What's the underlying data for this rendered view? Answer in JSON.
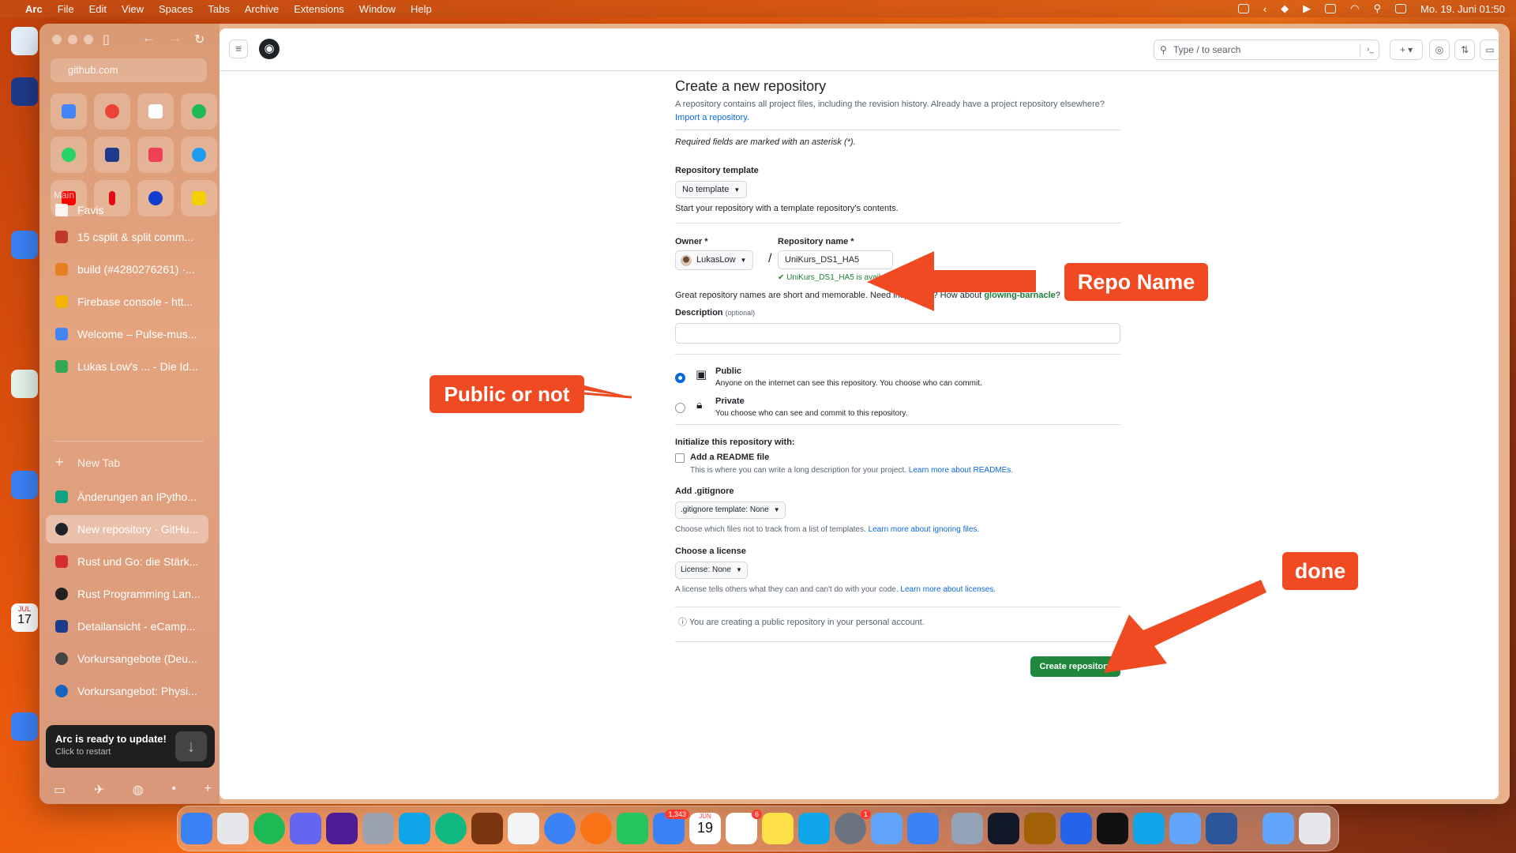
{
  "menubar": {
    "app": "Arc",
    "items": [
      "File",
      "Edit",
      "View",
      "Spaces",
      "Tabs",
      "Archive",
      "Extensions",
      "Window",
      "Help"
    ],
    "datetime": "Mo. 19. Juni 01:50"
  },
  "sidebar": {
    "url": "github.com",
    "sections": {
      "main": "Main",
      "favis": "Favis"
    },
    "pinned_tabs": [
      {
        "label": "15 csplit & split comm...",
        "color": "#c0392b"
      },
      {
        "label": "build (#4280276261) ·...",
        "color": "#e67e22"
      },
      {
        "label": "Firebase console - htt...",
        "color": "#f5b400"
      },
      {
        "label": "Welcome – Pulse-mus...",
        "color": "#4285f4"
      },
      {
        "label": "Lukas Low's ... - Die Id...",
        "color": "#34a853"
      }
    ],
    "new_tab": "New Tab",
    "tabs": [
      {
        "label": "Änderungen an IPytho...",
        "color": "#10a37f",
        "active": false
      },
      {
        "label": "New repository · GitHu...",
        "color": "#1f2328",
        "active": true
      },
      {
        "label": "Rust und Go: die Stärk...",
        "color": "#d32f2f",
        "active": false
      },
      {
        "label": "Rust Programming Lan...",
        "color": "#222222",
        "active": false
      },
      {
        "label": "Detailansicht - eCamp...",
        "color": "#1e3a8a",
        "active": false
      },
      {
        "label": "Vorkursangebote (Deu...",
        "color": "#444444",
        "active": false
      },
      {
        "label": "Vorkursangebot: Physi...",
        "color": "#1565c0",
        "active": false
      }
    ],
    "update": {
      "title": "Arc is ready to update!",
      "subtitle": "Click to restart"
    }
  },
  "github": {
    "search_placeholder": "Type / to search",
    "title": "Create a new repository",
    "intro_1": "A repository contains all project files, including the revision history. Already have a project repository",
    "intro_2": "elsewhere?",
    "import_link": "Import a repository.",
    "required_note": "Required fields are marked with an asterisk (*).",
    "template_label": "Repository template",
    "template_value": "No template",
    "template_help": "Start your repository with a template repository's contents.",
    "owner_label": "Owner *",
    "owner_value": "LukasLow",
    "slash": "/",
    "repo_label": "Repository name *",
    "repo_value": "UniKurs_DS1_HA5",
    "availability": "UniKurs_DS1_HA5 is available.",
    "inspiration": "Great repository names are short and memorable. Need inspiration? How about",
    "suggestion": "glowing-barnacle",
    "suggestion_end": "?",
    "description_label": "Description",
    "description_optional": "(optional)",
    "description_value": "",
    "visibility": [
      {
        "title": "Public",
        "desc": "Anyone on the internet can see this repository. You choose who can commit.",
        "selected": true
      },
      {
        "title": "Private",
        "desc": "You choose who can see and commit to this repository.",
        "selected": false
      }
    ],
    "init_label": "Initialize this repository with:",
    "readme_label": "Add a README file",
    "readme_help": "This is where you can write a long description for your project.",
    "readme_link": "Learn more about READMEs.",
    "gitignore_label": "Add .gitignore",
    "gitignore_value": ".gitignore template: None",
    "gitignore_help": "Choose which files not to track from a list of templates.",
    "gitignore_link": "Learn more about ignoring files.",
    "license_label": "Choose a license",
    "license_value": "License: None",
    "license_help": "A license tells others what they can and can't do with your code.",
    "license_link": "Learn more about licenses.",
    "notice": "You are creating a public repository in your personal account.",
    "create_button": "Create repository"
  },
  "annotations": {
    "repo_name": "Repo Name",
    "public": "Public or not",
    "done": "done"
  },
  "colors": {
    "annotation": "#f04a23",
    "create_button": "#1f883d",
    "link": "#0969da"
  },
  "dock": {
    "mail_badge": "1,343",
    "calendar_day": "19",
    "calendar_month": "JUN",
    "reminders_badge": "6",
    "settings_badge": "1",
    "desk_calendar_day": "17",
    "desk_calendar_month": "JUL"
  }
}
